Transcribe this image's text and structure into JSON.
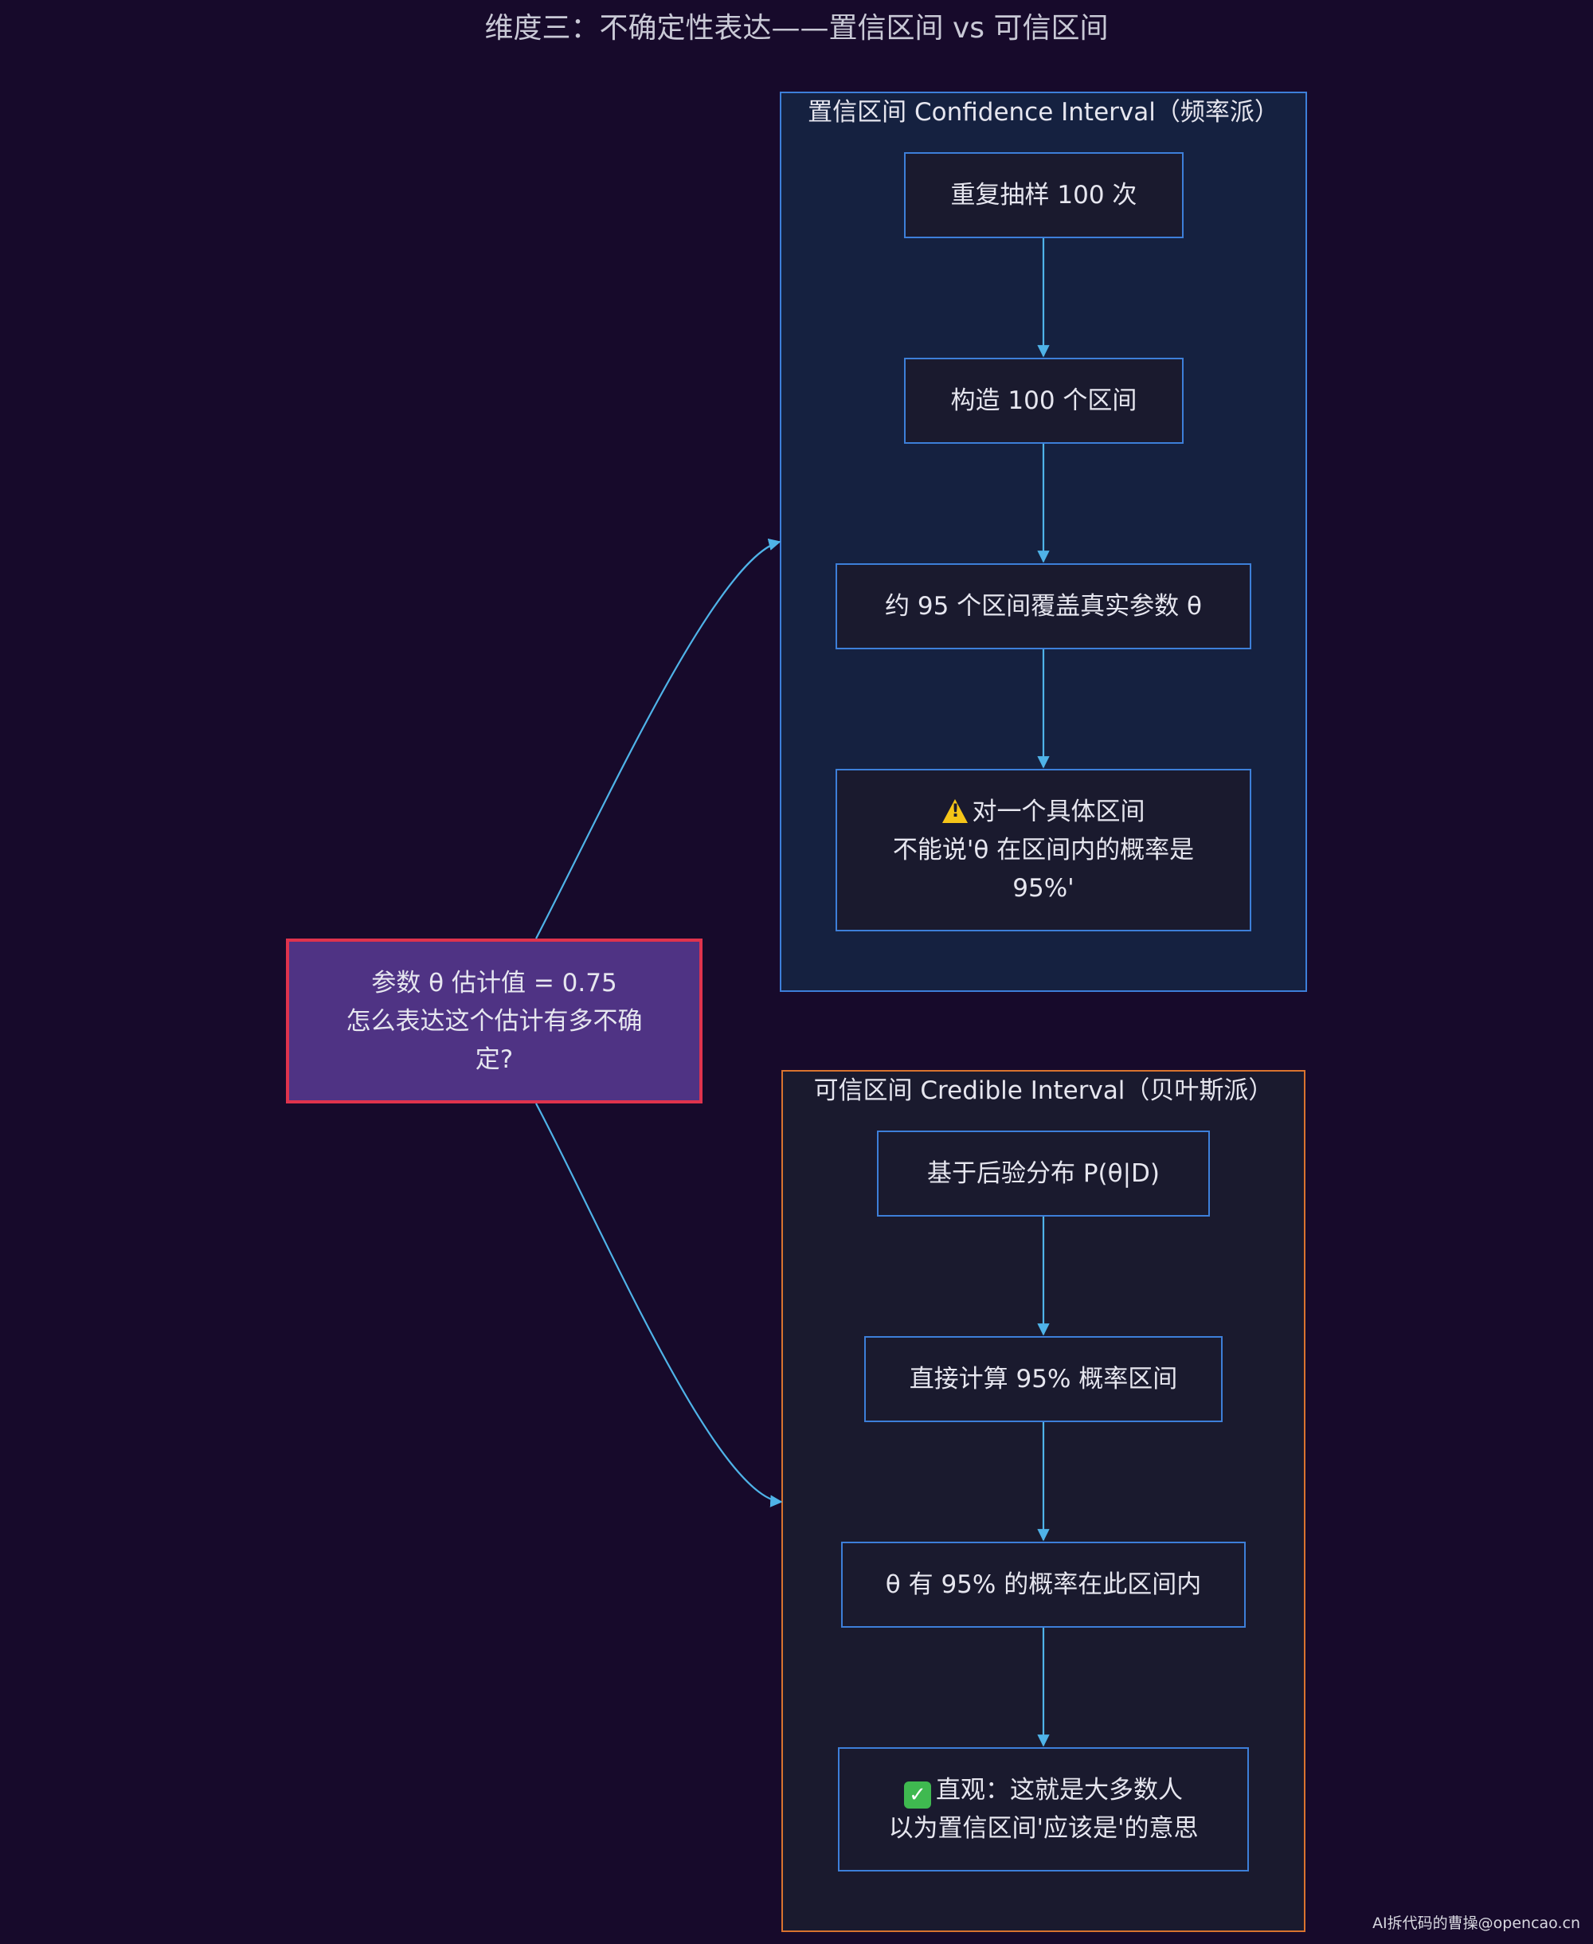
{
  "title": "维度三：不确定性表达——置信区间 vs 可信区间",
  "main_node": {
    "lines": [
      "参数 θ 估计值 = 0.75",
      "怎么表达这个估计有多不确",
      "定?"
    ]
  },
  "confidence_group": {
    "label": "置信区间 Confidence Interval（频率派）",
    "nodes": [
      {
        "lines": [
          "重复抽样 100 次"
        ]
      },
      {
        "lines": [
          "构造 100 个区间"
        ]
      },
      {
        "lines": [
          "约 95 个区间覆盖真实参数 θ"
        ]
      },
      {
        "icon": "warning-icon",
        "lines": [
          "对一个具体区间",
          "不能说'θ 在区间内的概率是",
          "95%'"
        ]
      }
    ]
  },
  "credible_group": {
    "label": "可信区间 Credible Interval（贝叶斯派）",
    "nodes": [
      {
        "lines": [
          "基于后验分布 P(θ|D)"
        ]
      },
      {
        "lines": [
          "直接计算 95% 概率区间"
        ]
      },
      {
        "lines": [
          "θ 有 95% 的概率在此区间内"
        ]
      },
      {
        "icon": "check-icon",
        "lines": [
          "直观：这就是大多数人",
          "以为置信区间'应该是'的意思"
        ]
      }
    ]
  },
  "watermark": "AI拆代码的曹操@opencao.cn",
  "colors": {
    "background": "#170a2b",
    "confidence_border": "#3d7fd9",
    "credible_border": "#d9732f",
    "main_fill": "#4f3384",
    "main_border": "#e0334d",
    "edge": "#4fb3e8"
  }
}
